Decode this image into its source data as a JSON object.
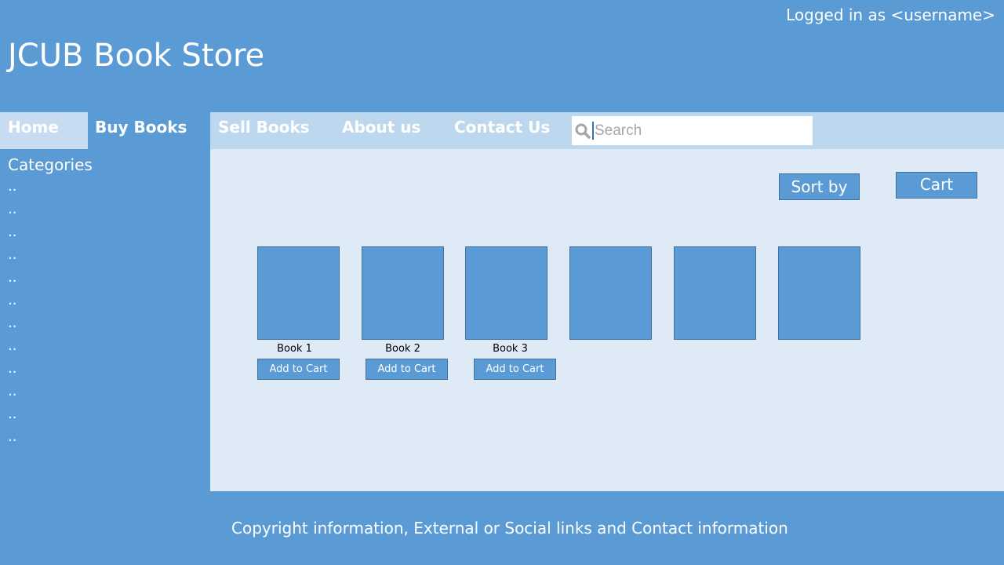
{
  "header": {
    "logged_in": "Logged in as <username>",
    "title": "JCUB Book Store"
  },
  "nav": {
    "home": "Home",
    "buy_books": "Buy Books",
    "sell_books": "Sell Books",
    "about_us": "About us",
    "contact_us": "Contact Us"
  },
  "search": {
    "placeholder": "Search",
    "icon": "search-icon"
  },
  "sidebar": {
    "title": "Categories",
    "items": [
      "..",
      "..",
      "..",
      "..",
      "..",
      "..",
      "..",
      "..",
      "..",
      "..",
      "..",
      ".."
    ]
  },
  "toolbar": {
    "sort_label": "Sort by",
    "cart_label": "Cart"
  },
  "books": [
    {
      "title": "Book 1",
      "add_label": "Add to Cart"
    },
    {
      "title": "Book 2",
      "add_label": "Add to Cart"
    },
    {
      "title": "Book 3",
      "add_label": "Add to Cart"
    },
    {
      "title": "",
      "add_label": ""
    },
    {
      "title": "",
      "add_label": ""
    },
    {
      "title": "",
      "add_label": ""
    }
  ],
  "footer": {
    "text": "Copyright information, External or Social links and Contact information"
  },
  "colors": {
    "primary": "#5b9bd5",
    "nav_bar": "#bdd7ee",
    "content_bg": "#deebf7",
    "border": "#41719c"
  }
}
